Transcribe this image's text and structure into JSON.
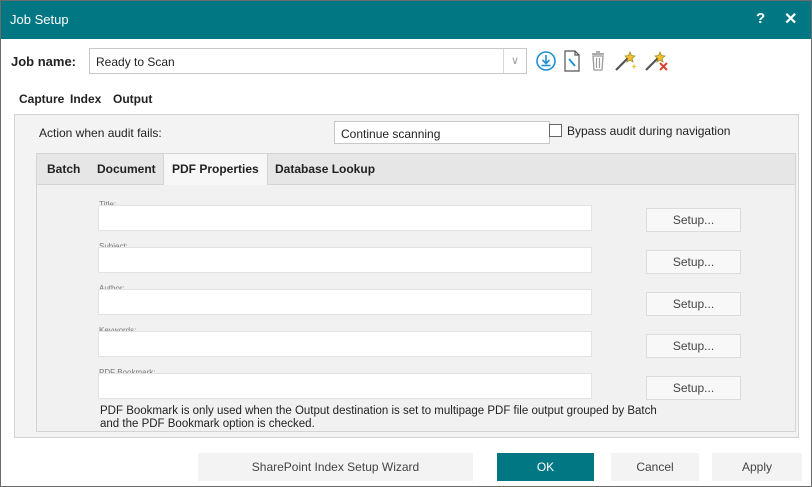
{
  "window": {
    "title": "Job Setup",
    "help_glyph": "?",
    "close_glyph": "✕"
  },
  "job": {
    "label": "Job name:",
    "value": "Ready to Scan"
  },
  "toolbar_icons": [
    "download-icon",
    "edit-document-icon",
    "trash-icon",
    "wand-icon",
    "wand-remove-icon"
  ],
  "main_tabs": [
    "Capture",
    "Index",
    "Output"
  ],
  "active_main_tab": "Index",
  "audit": {
    "label": "Action when audit fails:",
    "value": "Continue scanning",
    "bypass_label": "Bypass audit during navigation",
    "bypass_checked": false
  },
  "sub_tabs": [
    "Batch",
    "Document",
    "PDF Properties",
    "Database Lookup"
  ],
  "active_sub_tab": "PDF Properties",
  "pdf_fields": [
    {
      "label": "Title:",
      "value": "",
      "button": "Setup..."
    },
    {
      "label": "Subject:",
      "value": "",
      "button": "Setup..."
    },
    {
      "label": "Author:",
      "value": "",
      "button": "Setup..."
    },
    {
      "label": "Keywords:",
      "value": "",
      "button": "Setup..."
    },
    {
      "label": "PDF Bookmark:",
      "value": "",
      "button": "Setup..."
    }
  ],
  "note": "PDF Bookmark is only used when the Output destination is set to multipage PDF file output grouped by Batch and the PDF Bookmark option is checked.",
  "buttons": {
    "wizard": "SharePoint Index Setup Wizard",
    "ok": "OK",
    "cancel": "Cancel",
    "apply": "Apply"
  },
  "colors": {
    "accent": "#007782",
    "title_text": "#ffffff"
  }
}
